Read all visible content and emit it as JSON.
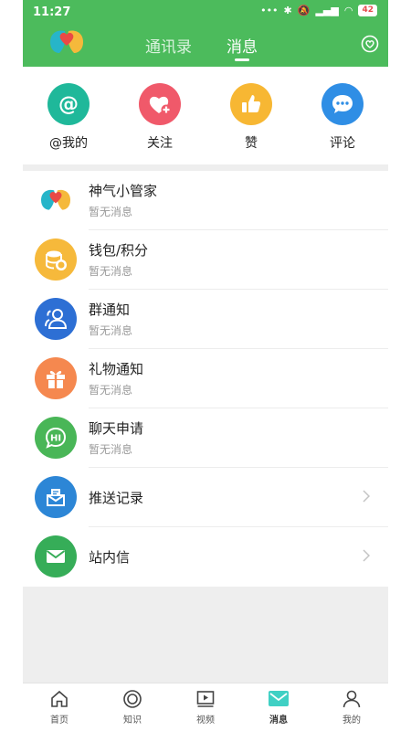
{
  "status": {
    "time": "11:27",
    "battery": "42"
  },
  "header": {
    "tabs": [
      {
        "label": "通讯录",
        "active": false
      },
      {
        "label": "消息",
        "active": true
      }
    ]
  },
  "quick_actions": [
    {
      "label": "@我的",
      "icon": "at-icon",
      "color": "#1fb89a"
    },
    {
      "label": "关注",
      "icon": "heart-plus-icon",
      "color": "#f0596a"
    },
    {
      "label": "赞",
      "icon": "thumbs-up-icon",
      "color": "#f7b733"
    },
    {
      "label": "评论",
      "icon": "comment-icon",
      "color": "#2f8ee5"
    }
  ],
  "messages": [
    {
      "title": "神气小管家",
      "subtitle": "暂无消息",
      "icon": "assistant-logo-icon"
    },
    {
      "title": "钱包/积分",
      "subtitle": "暂无消息",
      "icon": "coins-icon",
      "color": "#f6b93b"
    },
    {
      "title": "群通知",
      "subtitle": "暂无消息",
      "icon": "group-icon",
      "color": "#2d6fd4"
    },
    {
      "title": "礼物通知",
      "subtitle": "暂无消息",
      "icon": "gift-icon",
      "color": "#f5884f"
    },
    {
      "title": "聊天申请",
      "subtitle": "暂无消息",
      "icon": "chat-hi-icon",
      "color": "#49b657"
    }
  ],
  "links": [
    {
      "title": "推送记录",
      "icon": "inbox-icon",
      "color": "#2c86d6"
    },
    {
      "title": "站内信",
      "icon": "mail-icon",
      "color": "#36ad58"
    }
  ],
  "nav": {
    "items": [
      {
        "label": "首页",
        "icon": "home-icon"
      },
      {
        "label": "知识",
        "icon": "target-icon"
      },
      {
        "label": "视频",
        "icon": "video-icon"
      },
      {
        "label": "消息",
        "icon": "message-icon",
        "active": true
      },
      {
        "label": "我的",
        "icon": "profile-icon"
      }
    ]
  }
}
